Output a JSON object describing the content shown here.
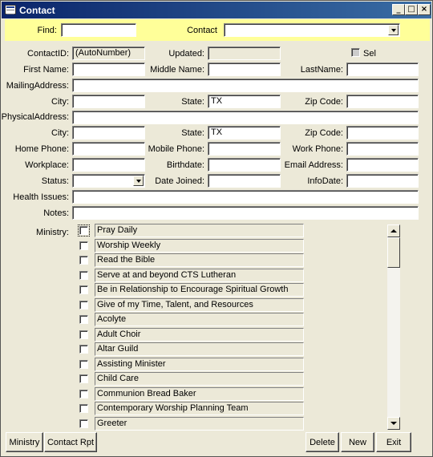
{
  "window": {
    "title": "Contact"
  },
  "finder": {
    "find_label": "Find:",
    "find_value": "",
    "contact_label": "Contact",
    "contact_value": ""
  },
  "form": {
    "contact_id": {
      "label": "ContactID:",
      "value": "(AutoNumber)"
    },
    "updated": {
      "label": "Updated:",
      "value": ""
    },
    "sel": {
      "label": "Sel"
    },
    "first_name": {
      "label": "First Name:",
      "value": ""
    },
    "middle_name": {
      "label": "Middle Name:",
      "value": ""
    },
    "last_name": {
      "label": "LastName:",
      "value": ""
    },
    "mailing_address": {
      "label": "MailingAddress:",
      "value": ""
    },
    "mailing_city": {
      "label": "City:",
      "value": ""
    },
    "mailing_state": {
      "label": "State:",
      "value": "TX"
    },
    "mailing_zip": {
      "label": "Zip Code:",
      "value": ""
    },
    "physical_address": {
      "label": "PhysicalAddress:",
      "value": ""
    },
    "physical_city": {
      "label": "City:",
      "value": ""
    },
    "physical_state": {
      "label": "State:",
      "value": "TX"
    },
    "physical_zip": {
      "label": "Zip Code:",
      "value": ""
    },
    "home_phone": {
      "label": "Home Phone:",
      "value": ""
    },
    "mobile_phone": {
      "label": "Mobile Phone:",
      "value": ""
    },
    "work_phone": {
      "label": "Work Phone:",
      "value": ""
    },
    "workplace": {
      "label": "Workplace:",
      "value": ""
    },
    "birthdate": {
      "label": "Birthdate:",
      "value": ""
    },
    "email": {
      "label": "Email Address:",
      "value": ""
    },
    "status": {
      "label": "Status:",
      "value": ""
    },
    "date_joined": {
      "label": "Date Joined:",
      "value": ""
    },
    "info_date": {
      "label": "InfoDate:",
      "value": ""
    },
    "health_issues": {
      "label": "Health Issues:",
      "value": ""
    },
    "notes": {
      "label": "Notes:",
      "value": ""
    },
    "ministry_label": "Ministry:"
  },
  "ministries": [
    "Pray Daily",
    "Worship Weekly",
    "Read the Bible",
    "Serve at and beyond CTS Lutheran",
    "Be in Relationship to Encourage Spiritual Growth",
    "Give of my Time, Talent, and Resources",
    "Acolyte",
    "Adult Choir",
    "Altar Guild",
    "Assisting Minister",
    "Child Care",
    "Communion Bread Baker",
    "Contemporary Worship Planning Team",
    "Greeter"
  ],
  "buttons": {
    "ministry": "Ministry",
    "contact_rpt": "Contact Rpt",
    "delete": "Delete",
    "new": "New",
    "exit": "Exit"
  }
}
